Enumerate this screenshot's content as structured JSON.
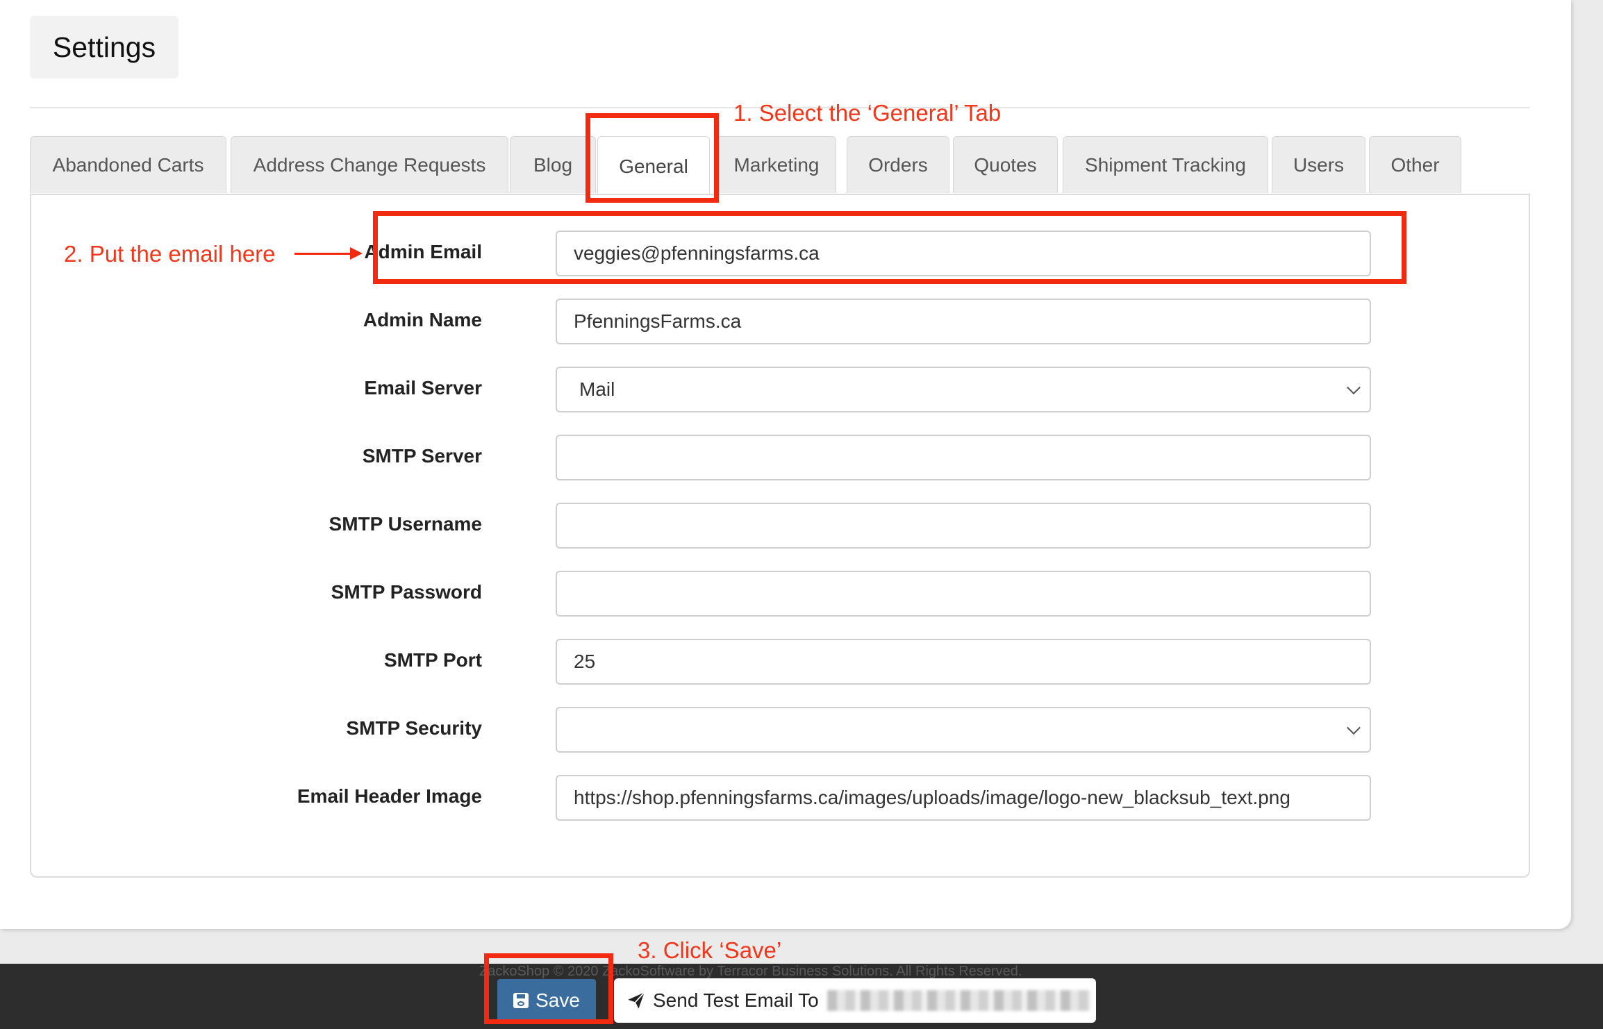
{
  "page": {
    "title": "Settings"
  },
  "tabs": [
    {
      "label": "Abandoned Carts"
    },
    {
      "label": "Address Change Requests"
    },
    {
      "label": "Blog"
    },
    {
      "label": "General"
    },
    {
      "label": "Marketing"
    },
    {
      "label": "Orders"
    },
    {
      "label": "Quotes"
    },
    {
      "label": "Shipment Tracking"
    },
    {
      "label": "Users"
    },
    {
      "label": "Other"
    }
  ],
  "active_tab": "General",
  "form": {
    "admin_email": {
      "label": "Admin Email",
      "value": "veggies@pfenningsfarms.ca"
    },
    "admin_name": {
      "label": "Admin Name",
      "value": "PfenningsFarms.ca"
    },
    "email_server": {
      "label": "Email Server",
      "value": "Mail"
    },
    "smtp_server": {
      "label": "SMTP Server",
      "value": ""
    },
    "smtp_username": {
      "label": "SMTP Username",
      "value": ""
    },
    "smtp_password": {
      "label": "SMTP Password",
      "value": ""
    },
    "smtp_port": {
      "label": "SMTP Port",
      "value": "25"
    },
    "smtp_security": {
      "label": "SMTP Security",
      "value": ""
    },
    "email_header_image": {
      "label": "Email Header Image",
      "value": "https://shop.pfenningsfarms.ca/images/uploads/image/logo-new_blacksub_text.png"
    }
  },
  "annotations": {
    "step1": "1. Select the ‘General’ Tab",
    "step2": "2. Put the email here",
    "step3": "3. Click ‘Save’"
  },
  "footer": {
    "copyright": "ZackoShop © 2020 ZackoSoftware by Terracor Business Solutions. All Rights Reserved.",
    "save_label": "Save",
    "send_test_label": "Send Test Email To"
  },
  "colors": {
    "annotation_red": "#f22a12",
    "save_button": "#3a6c9e",
    "footer_bar": "#2d2d2d"
  }
}
